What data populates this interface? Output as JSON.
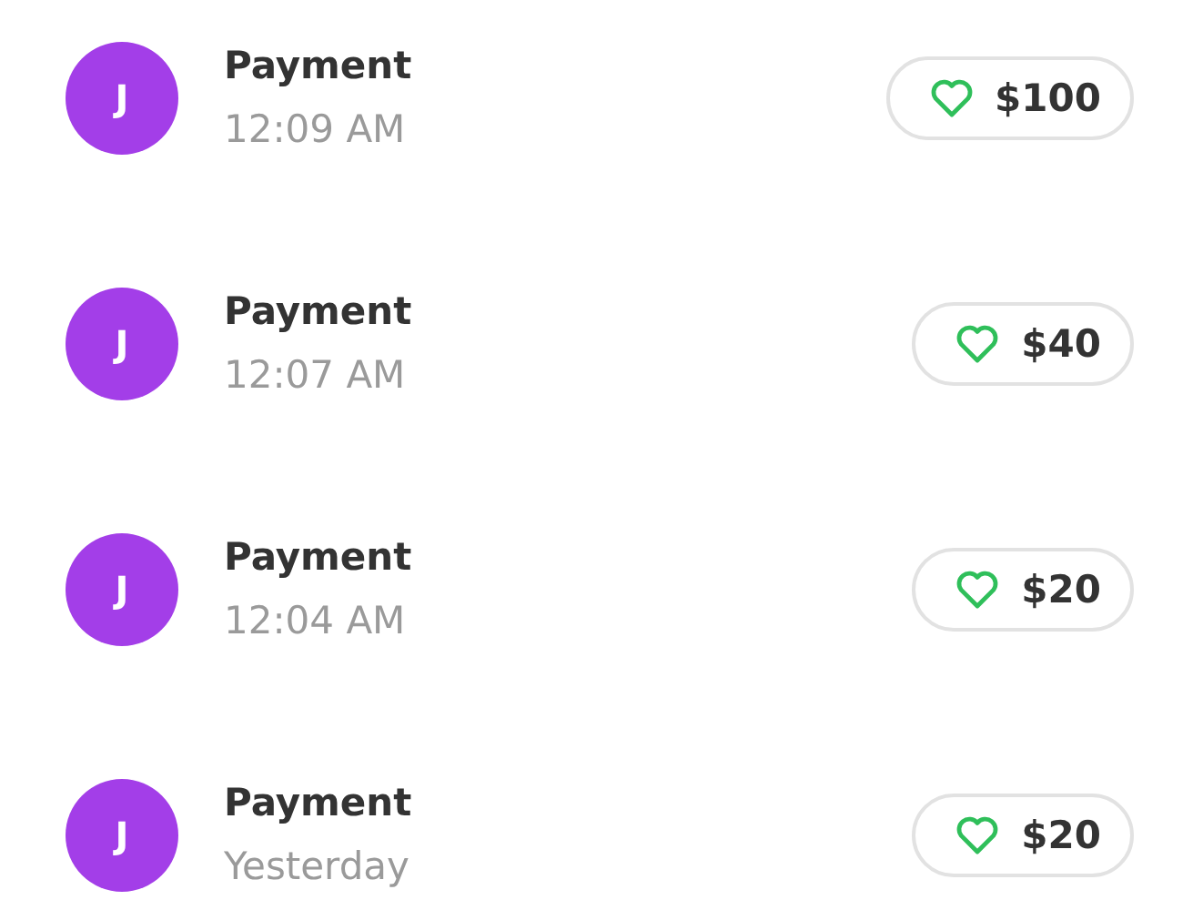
{
  "transactions": [
    {
      "initial": "J",
      "title": "Payment",
      "time": "12:09 AM",
      "amount": "$100"
    },
    {
      "initial": "J",
      "title": "Payment",
      "time": "12:07 AM",
      "amount": "$40"
    },
    {
      "initial": "J",
      "title": "Payment",
      "time": "12:04 AM",
      "amount": "$20"
    },
    {
      "initial": "J",
      "title": "Payment",
      "time": "Yesterday",
      "amount": "$20"
    }
  ]
}
